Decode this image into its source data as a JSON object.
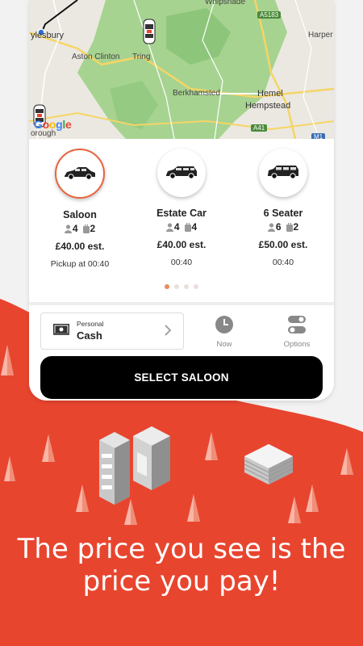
{
  "map": {
    "labels": {
      "aylesbury": "ylesbury",
      "whipsnade": "Whipsnade",
      "harpenden": "Harper",
      "aston_clinton": "Aston Clinton",
      "tring": "Tring",
      "berkhamsted": "Berkhamsted",
      "hemel": "Hemel",
      "hempstead": "Hempstead",
      "borough": "orough",
      "road_a5183": "A5183",
      "road_a41": "A41",
      "road_m1": "M1"
    },
    "google_logo": "Google"
  },
  "vehicles": [
    {
      "name": "Saloon",
      "passengers": "4",
      "bags": "2",
      "price": "£40.00 est.",
      "time": "Pickup at 00:40",
      "selected": true
    },
    {
      "name": "Estate Car",
      "passengers": "4",
      "bags": "4",
      "price": "£40.00 est.",
      "time": "00:40",
      "selected": false
    },
    {
      "name": "6 Seater",
      "passengers": "6",
      "bags": "2",
      "price": "£50.00 est.",
      "time": "00:40",
      "selected": false
    }
  ],
  "pagination": {
    "total": 4,
    "active": 0
  },
  "payment": {
    "type": "Personal",
    "method": "Cash"
  },
  "options": {
    "now_label": "Now",
    "options_label": "Options"
  },
  "select_button": "SELECT SALOON",
  "tagline": {
    "line1": "The price you see is the",
    "line2": "price you pay!"
  },
  "colors": {
    "accent": "#e8452f",
    "selected_ring": "#e8643c",
    "button": "#000000",
    "map_green": "#9bcf88"
  }
}
